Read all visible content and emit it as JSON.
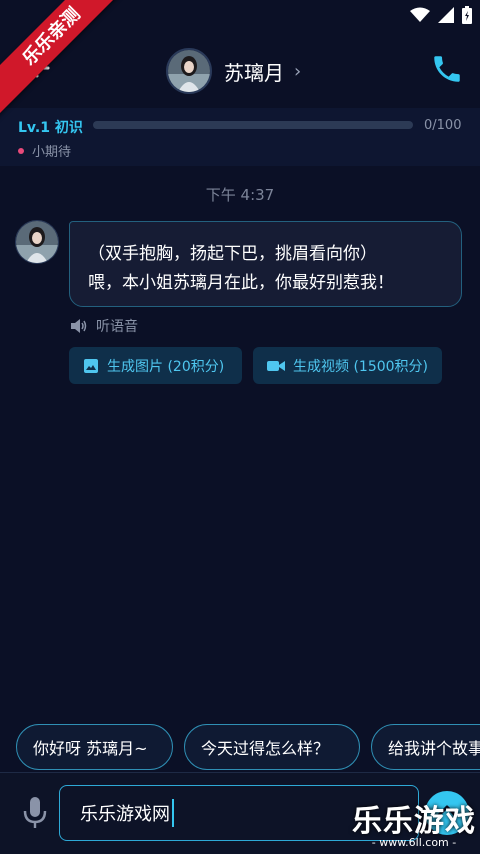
{
  "header": {
    "contact_name": "苏璃月",
    "chevron": "›"
  },
  "level": {
    "label": "Lv.1 初识",
    "progress_text": "0/100",
    "progress_value": 0,
    "progress_max": 100,
    "mood": "小期待"
  },
  "chat": {
    "timestamp": "下午 4:37",
    "message_line1": "（双手抱胸，扬起下巴，挑眉看向你）",
    "message_line2": "喂，本小姐苏璃月在此，你最好别惹我！",
    "listen_label": "听语音",
    "gen_image_label": "生成图片 (20积分)",
    "gen_video_label": "生成视频 (1500积分)"
  },
  "suggestions": [
    "你好呀 苏璃月~",
    "今天过得怎么样？",
    "给我讲个故事"
  ],
  "input": {
    "value": "乐乐游戏网"
  },
  "overlays": {
    "corner_banner": "乐乐亲测",
    "watermark_main": "乐乐游戏",
    "watermark_url": "- www.6ll.com -"
  },
  "colors": {
    "background": "#0b1026",
    "accent": "#34c6f0",
    "mood_dot": "#e84a7a"
  }
}
